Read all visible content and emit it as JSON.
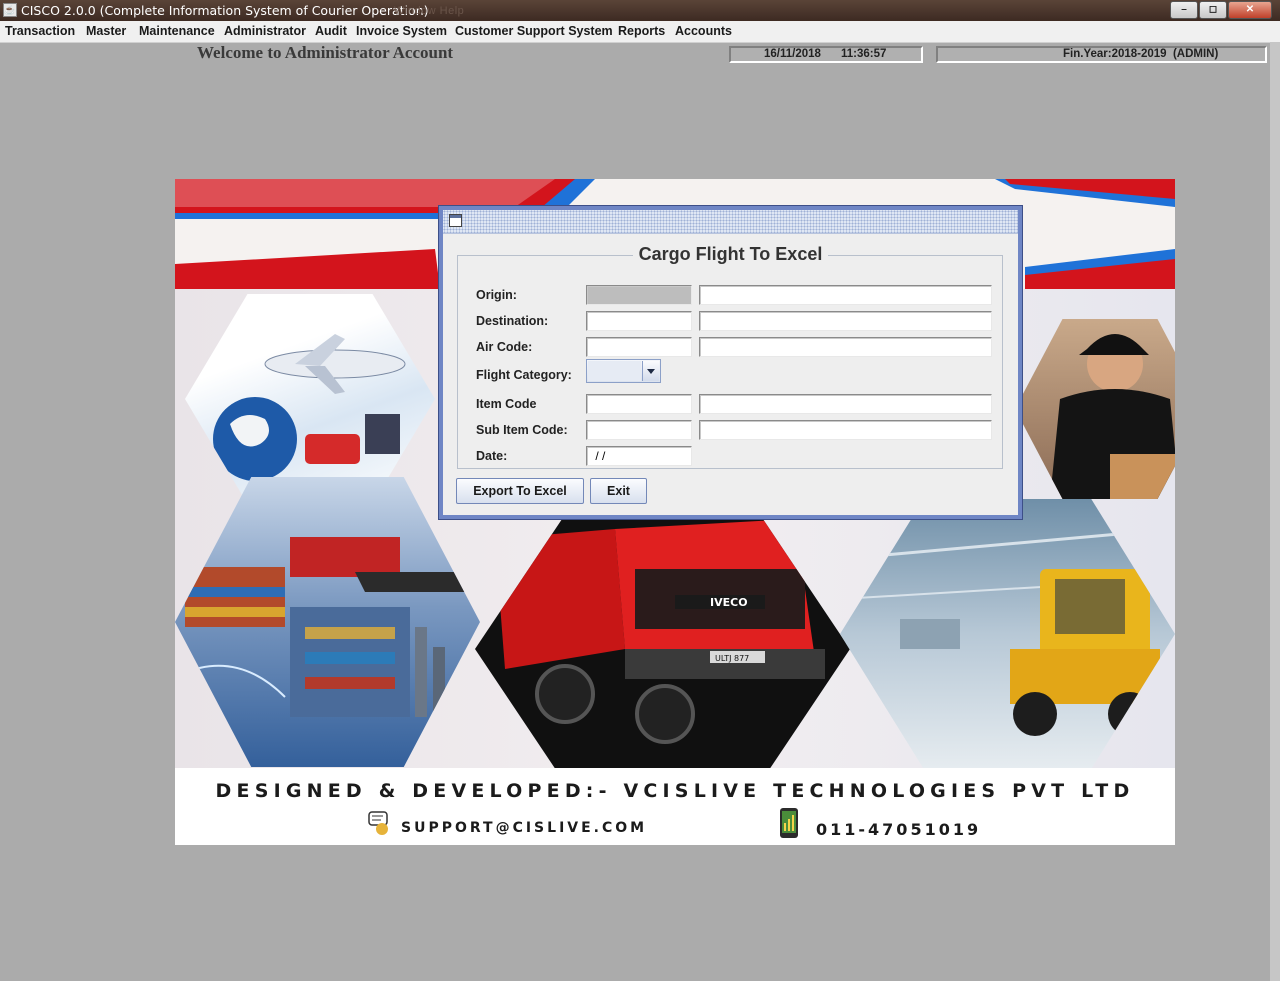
{
  "window": {
    "title": "CISCO 2.0.0 (Complete Information System of Courier Operation)",
    "ghost_title": "Window    Help",
    "controls": [
      "–",
      "◻",
      "✕"
    ]
  },
  "menu": {
    "items": [
      "Transaction",
      "Master",
      "Maintenance",
      "Administrator",
      "Audit",
      "Invoice System",
      "Customer Support System",
      "Reports",
      "Accounts"
    ]
  },
  "header": {
    "welcome": "Welcome to Administrator Account",
    "date": "16/11/2018",
    "time": "11:36:57",
    "fin_year": "Fin.Year:2018-2019  (ADMIN)"
  },
  "banner": {
    "designed_by": "DESIGNED & DEVELOPED:- VCISLIVE TECHNOLOGIES PVT LTD",
    "email": "SUPPORT@CISLIVE.COM",
    "phone": "011-47051019",
    "truck_brand": "IVECO",
    "plate": "ULTJ 877"
  },
  "dialog": {
    "title": "Cargo Flight To Excel",
    "labels": {
      "origin": "Origin:",
      "destination": "Destination:",
      "air_code": "Air Code:",
      "flight_category": "Flight Category:",
      "item_code": "Item Code",
      "sub_item_code": "Sub Item Code:",
      "date": "Date:"
    },
    "values": {
      "origin_code": "",
      "origin_name": "",
      "destination_code": "",
      "destination_name": "",
      "air_code": "",
      "air_name": "",
      "flight_category": "",
      "item_code": "",
      "item_name": "",
      "sub_item_code": "",
      "sub_item_name": "",
      "date": " / /"
    },
    "buttons": {
      "export": "Export To Excel",
      "exit": "Exit"
    }
  },
  "colors": {
    "desktop": "#ababab",
    "title_bar": "#4a352b",
    "dialog_border": "#6f86c5",
    "banner_red": "#d3141c",
    "banner_blue": "#1f72d8"
  }
}
